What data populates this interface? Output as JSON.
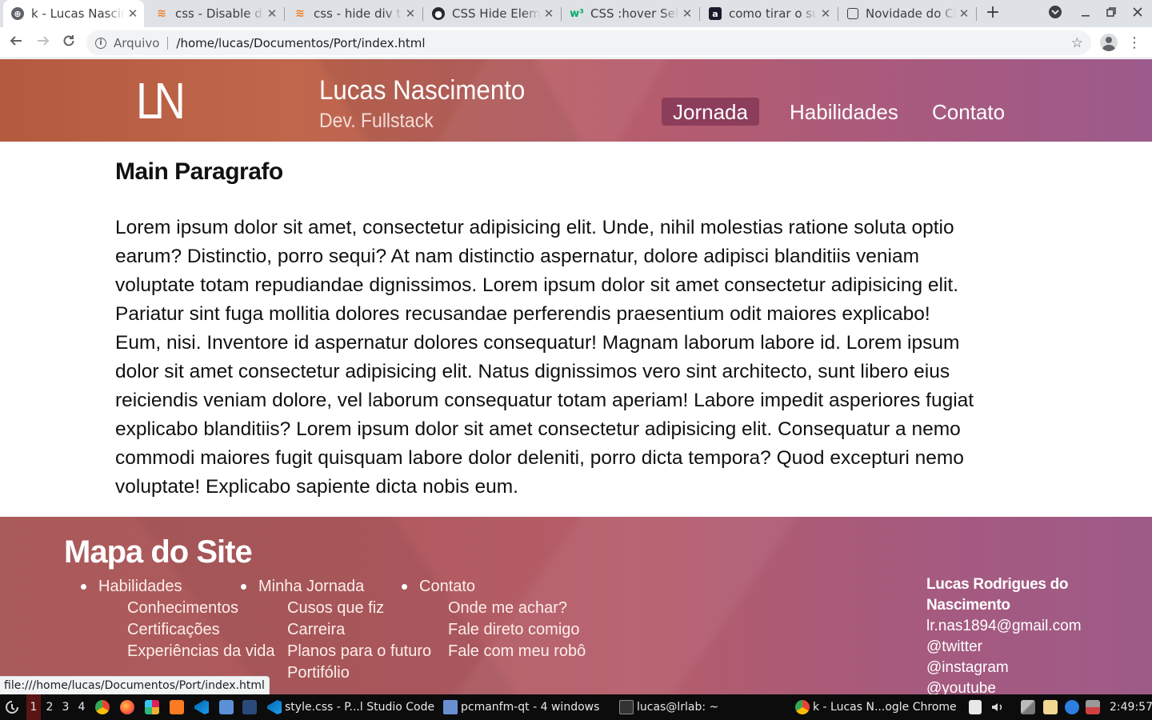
{
  "browser": {
    "tabs": [
      {
        "title": "k - Lucas Nascimento",
        "favicon": "globe-icon",
        "color": "#5f6368",
        "active": true
      },
      {
        "title": "css - Disable default",
        "favicon": "stackoverflow-icon",
        "color": "#f48024",
        "active": false
      },
      {
        "title": "css - hide div tag",
        "favicon": "stackoverflow-icon",
        "color": "#f48024",
        "active": false
      },
      {
        "title": "CSS Hide Element",
        "favicon": "github-icon",
        "color": "#24292e",
        "active": false
      },
      {
        "title": "CSS :hover Selector",
        "favicon": "w3schools-icon",
        "color": "#04aa6d",
        "active": false
      },
      {
        "title": "como tirar o sublinhado",
        "favicon": "a-icon",
        "color": "#1a1a2e",
        "active": false
      },
      {
        "title": "Novidade do Chrome",
        "favicon": "page-icon",
        "color": "#5f6368",
        "active": false
      }
    ],
    "new_tab_label": "+",
    "omnibox": {
      "scheme_label": "Arquivo",
      "url": "/home/lucas/Documentos/Port/index.html"
    },
    "status_url": "file:///home/lucas/Documentos/Port/index.html"
  },
  "header": {
    "logo": "LN",
    "name": "Lucas Nascimento",
    "role": "Dev. Fullstack",
    "nav": [
      {
        "label": "Jornada",
        "active": true
      },
      {
        "label": "Habilidades",
        "active": false
      },
      {
        "label": "Contato",
        "active": false
      }
    ]
  },
  "main": {
    "title": "Main Paragrafo",
    "paragraph": "Lorem ipsum dolor sit amet, consectetur adipisicing elit. Unde, nihil molestias ratione soluta optio earum? Distinctio, porro sequi? At nam distinctio aspernatur, dolore adipisci blanditiis veniam voluptate totam repudiandae dignissimos. Lorem ipsum dolor sit amet consectetur adipisicing elit. Pariatur sint fuga mollitia dolores recusandae perferendis praesentium odit maiores explicabo! Eum, nisi. Inventore id aspernatur dolores consequatur! Magnam laborum labore id. Lorem ipsum dolor sit amet consectetur adipisicing elit. Natus dignissimos vero sint architecto, sunt libero eius reiciendis veniam dolore, vel laborum consequatur totam aperiam! Labore impedit asperiores fugiat explicabo blanditiis? Lorem ipsum dolor sit amet consectetur adipisicing elit. Consequatur a nemo commodi maiores fugit quisquam labore dolor deleniti, porro dicta tempora? Quod excepturi nemo voluptate! Explicabo sapiente dicta nobis eum."
  },
  "footer": {
    "title": "Mapa do Site",
    "columns": [
      {
        "head": "Habilidades",
        "items": [
          "Conhecimentos",
          "Certificações",
          "Experiências da vida"
        ]
      },
      {
        "head": "Minha Jornada",
        "items": [
          "Cusos que fiz",
          "Carreira",
          "Planos para o futuro",
          "Portifólio"
        ]
      },
      {
        "head": "Contato",
        "items": [
          "Onde me achar?",
          "Fale direto comigo",
          "Fale com meu robô"
        ]
      }
    ],
    "contact": {
      "name": "Lucas Rodrigues do Nascimento",
      "email": "lr.nas1894@gmail.com",
      "twitter": "@twitter",
      "instagram": "@instagram",
      "youtube": "@youtube"
    }
  },
  "taskbar": {
    "desktops": [
      "1",
      "2",
      "3",
      "4"
    ],
    "tasks": [
      {
        "label": "style.css - P...l Studio Code",
        "icon": "vscode-icon"
      },
      {
        "label": "pcmanfm-qt - 4 windows",
        "icon": "folder-icon"
      },
      {
        "label": "lucas@lrlab: ~",
        "icon": "terminal-icon"
      },
      {
        "label": "k - Lucas N...ogle Chrome",
        "icon": "chrome-icon"
      }
    ],
    "clock": "2:49:57"
  }
}
